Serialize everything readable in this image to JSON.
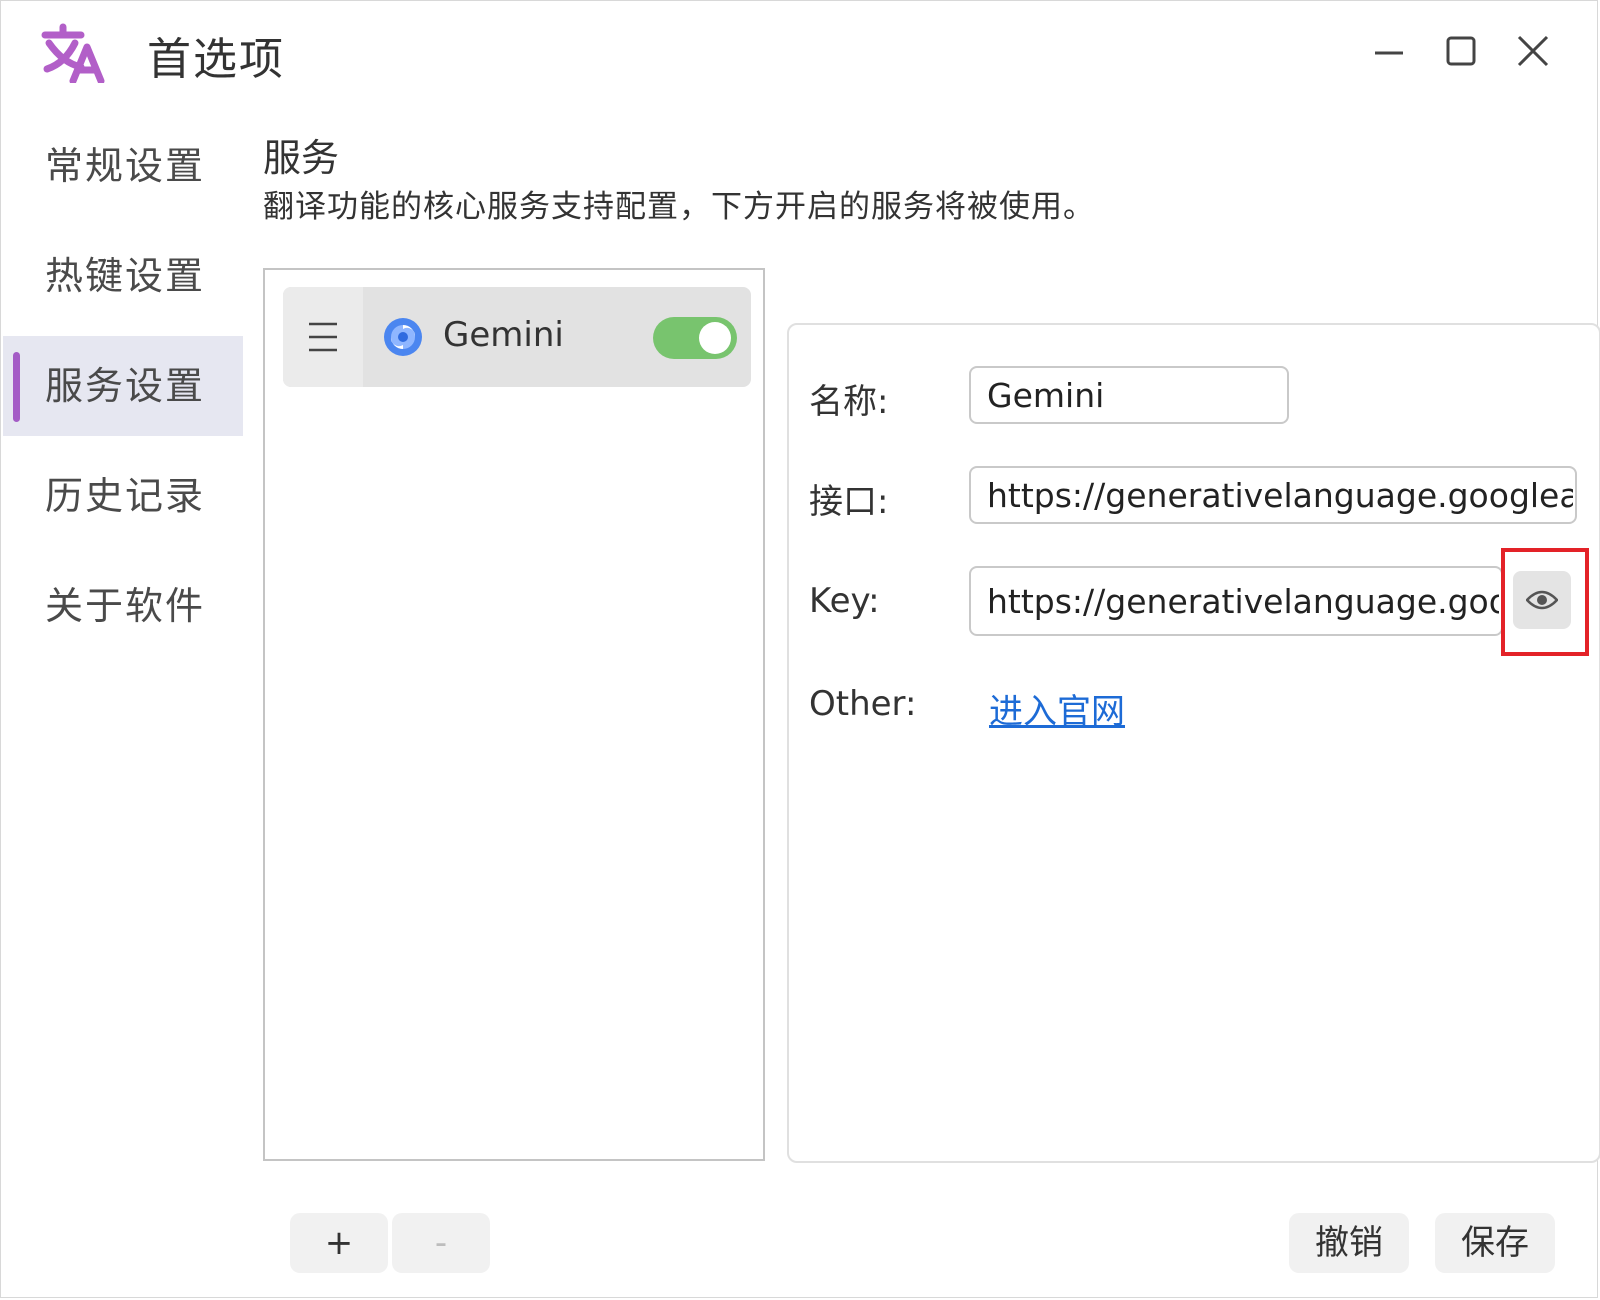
{
  "window": {
    "title": "首选项",
    "app_icon": "translate-icon",
    "accent_color": "#a45cc6"
  },
  "sidebar": {
    "items": [
      {
        "label": "常规设置",
        "active": false
      },
      {
        "label": "热键设置",
        "active": false
      },
      {
        "label": "服务设置",
        "active": true
      },
      {
        "label": "历史记录",
        "active": false
      },
      {
        "label": "关于软件",
        "active": false
      }
    ]
  },
  "header": {
    "title": "服务",
    "description": "翻译功能的核心服务支持配置，下方开启的服务将被使用。"
  },
  "services": [
    {
      "name": "Gemini",
      "icon": "gemini-icon",
      "enabled": true,
      "toggle_color": "#78c46e"
    }
  ],
  "config": {
    "name_label": "名称:",
    "name_value": "Gemini",
    "api_label": "接口:",
    "api_value": "https://generativelanguage.googleapis.com",
    "key_label": "Key:",
    "key_value": "https://generativelanguage.googleapis.com",
    "other_label": "Other:",
    "link_text": "进入官网",
    "reveal_icon": "eye-icon"
  },
  "footer": {
    "add_label": "+",
    "remove_label": "-",
    "cancel_label": "撤销",
    "save_label": "保存"
  }
}
